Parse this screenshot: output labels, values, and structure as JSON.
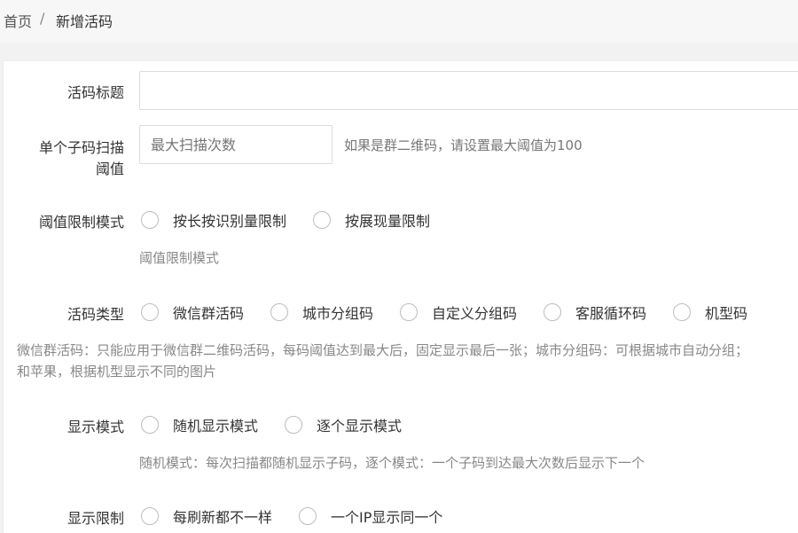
{
  "breadcrumb": {
    "home": "首页",
    "separator": "/",
    "current": "新增活码"
  },
  "form": {
    "title": {
      "label": "活码标题",
      "value": "",
      "placeholder": ""
    },
    "threshold": {
      "label_line1": "单个子码扫描",
      "label_line2": "阈值",
      "placeholder": "最大扫描次数",
      "hint": "如果是群二维码，请设置最大阈值为100"
    },
    "limit_mode": {
      "label": "阈值限制模式",
      "options": [
        "按长按识别量限制",
        "按展现量限制"
      ],
      "tip": "阈值限制模式"
    },
    "code_type": {
      "label": "活码类型",
      "options": [
        "微信群活码",
        "城市分组码",
        "自定义分组码",
        "客服循环码",
        "机型码"
      ],
      "description_line1": "微信群活码：只能应用于微信群二维码活码，每码阈值达到最大后，固定显示最后一张；城市分组码：可根据城市自动分组；",
      "description_line2": "和苹果，根据机型显示不同的图片"
    },
    "display_mode": {
      "label": "显示模式",
      "options": [
        "随机显示模式",
        "逐个显示模式"
      ],
      "tip": "随机模式：每次扫描都随机显示子码，逐个模式：一个子码到达最大次数后显示下一个"
    },
    "display_limit": {
      "label": "显示限制",
      "options": [
        "每刷新都不一样",
        "一个IP显示同一个"
      ]
    }
  }
}
